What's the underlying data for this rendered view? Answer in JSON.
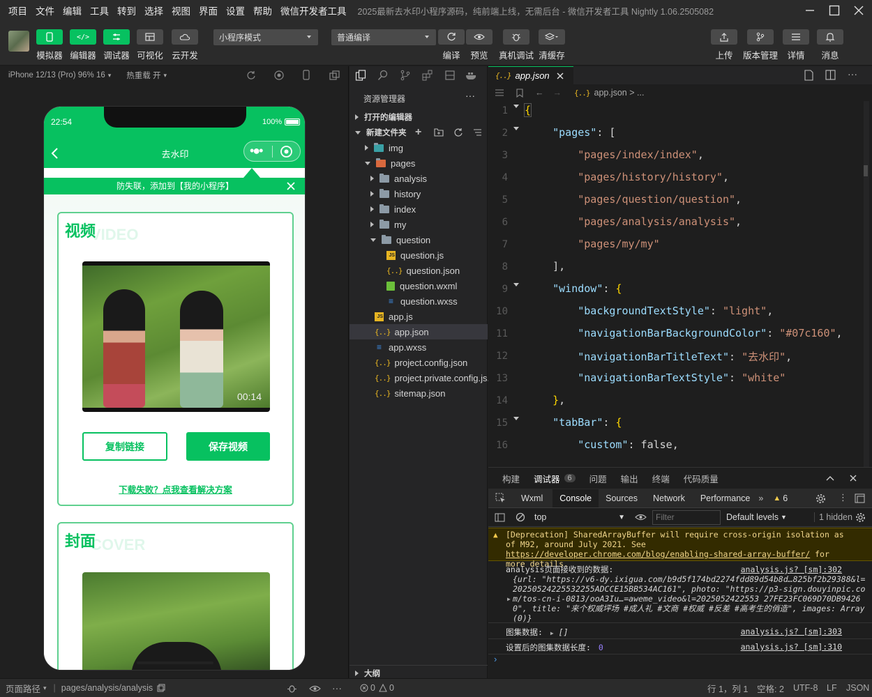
{
  "menu": [
    "项目",
    "文件",
    "编辑",
    "工具",
    "转到",
    "选择",
    "视图",
    "界面",
    "设置",
    "帮助",
    "微信开发者工具"
  ],
  "window_title": "2025最新去水印小程序源码，纯前端上线，无需后台 - 微信开发者工具 Nightly 1.06.2505082",
  "toolbar": {
    "left_buttons": [
      "模拟器",
      "编辑器",
      "调试器",
      "可视化",
      "云开发"
    ],
    "mode_select": "小程序模式",
    "compile_select": "普通编译",
    "mid_buttons": [
      "编译",
      "预览",
      "真机调试",
      "清缓存"
    ],
    "right_buttons": [
      "上传",
      "版本管理",
      "详情",
      "消息"
    ]
  },
  "simulator": {
    "device": "iPhone 12/13 (Pro) 96% 16",
    "hot_reload": "热重载 开",
    "time": "22:54",
    "battery": "100%",
    "nav_title": "去水印",
    "tip": "防失联，添加到【我的小程序】",
    "video_card": {
      "title": "视频",
      "ghost": "VIDEO",
      "duration": "00:14",
      "copy_btn": "复制链接",
      "save_btn": "保存视频",
      "help_link": "下载失败？点我查看解决方案"
    },
    "cover_card": {
      "title": "封面",
      "ghost": "COVER"
    }
  },
  "explorer": {
    "header": "资源管理器",
    "open_editors": "打开的编辑器",
    "project": "新建文件夹",
    "items": [
      {
        "name": "img",
        "type": "folder",
        "depth": 1,
        "expanded": false
      },
      {
        "name": "pages",
        "type": "folder",
        "depth": 1,
        "expanded": true
      },
      {
        "name": "analysis",
        "type": "folder",
        "depth": 2,
        "expanded": false
      },
      {
        "name": "history",
        "type": "folder",
        "depth": 2,
        "expanded": false
      },
      {
        "name": "index",
        "type": "folder",
        "depth": 2,
        "expanded": false
      },
      {
        "name": "my",
        "type": "folder",
        "depth": 2,
        "expanded": false
      },
      {
        "name": "question",
        "type": "folder",
        "depth": 2,
        "expanded": true
      },
      {
        "name": "question.js",
        "type": "js",
        "depth": 3
      },
      {
        "name": "question.json",
        "type": "json",
        "depth": 3
      },
      {
        "name": "question.wxml",
        "type": "wxml",
        "depth": 3
      },
      {
        "name": "question.wxss",
        "type": "wxss",
        "depth": 3
      },
      {
        "name": "app.js",
        "type": "js",
        "depth": 1
      },
      {
        "name": "app.json",
        "type": "json",
        "depth": 1,
        "selected": true
      },
      {
        "name": "app.wxss",
        "type": "wxss",
        "depth": 1
      },
      {
        "name": "project.config.json",
        "type": "json",
        "depth": 1
      },
      {
        "name": "project.private.config.js...",
        "type": "json",
        "depth": 1
      },
      {
        "name": "sitemap.json",
        "type": "json",
        "depth": 1
      }
    ],
    "outline": "大纲"
  },
  "editor": {
    "tab": "app.json",
    "breadcrumb": "app.json > ...",
    "line_numbers": [
      "1",
      "2",
      "3",
      "4",
      "5",
      "6",
      "7",
      "8",
      "9",
      "10",
      "11",
      "12",
      "13",
      "14",
      "15",
      "16"
    ],
    "code_lines": [
      "{",
      "    \"pages\": [",
      "        \"pages/index/index\",",
      "        \"pages/history/history\",",
      "        \"pages/question/question\",",
      "        \"pages/analysis/analysis\",",
      "        \"pages/my/my\"",
      "    ],",
      "    \"window\": {",
      "        \"backgroundTextStyle\": \"light\",",
      "        \"navigationBarBackgroundColor\": \"#07c160\",",
      "        \"navigationBarTitleText\": \"去水印\",",
      "        \"navigationBarTextStyle\": \"white\"",
      "    },",
      "    \"tabBar\": {",
      "        \"custom\": false,"
    ]
  },
  "panel": {
    "tabs": [
      "构建",
      "调试器",
      "问题",
      "输出",
      "终端",
      "代码质量"
    ],
    "debugger_badge": "6",
    "devtools_tabs": [
      "Wxml",
      "Console",
      "Sources",
      "Network",
      "Performance"
    ],
    "warn_count": "6",
    "context": "top",
    "filter_placeholder": "Filter",
    "levels": "Default levels",
    "hidden": "1 hidden",
    "warning_msg": "[Deprecation] SharedArrayBuffer will require cross-origin isolation as of M92, around July 2021. See ",
    "warning_link": "https://developer.chrome.com/blog/enabling-shared-array-buffer/",
    "warning_tail": " for more details.",
    "log1_label": "analysis页面接收到的数据:",
    "log1_src": "analysis.js? [sm]:302",
    "log1_body": "{url: \"https://v6-dy.ixigua.com/b9d5f174bd2274fdd89d54b8d…825bf2b29388&l=20250524225532255ADCCE15BB534AC161\", photo: \"https://p3-sign.douyinpic.com/tos-cn-i-0813/ooA3Iu…=aweme_video&l=2025052422553 27FE23FC069D70DB94260\", title: \"来个权威坪场 #成人礼 #文商 #权威 #反差 #高考生的俏造\", images: Array(0)}",
    "log2_label": "图集数据:",
    "log2_val": "[]",
    "log2_src": "analysis.js? [sm]:303",
    "log3_label": "设置后的图集数据长度:",
    "log3_val": "0",
    "log3_src": "analysis.js? [sm]:310"
  },
  "status": {
    "page_path_label": "页面路径",
    "page_path": "pages/analysis/analysis",
    "errors": "0",
    "warnings": "0",
    "position": "行 1，列 1",
    "spaces": "空格: 2",
    "encoding": "UTF-8",
    "eol": "LF",
    "lang": "JSON"
  },
  "colors": {
    "brand": "#07c160"
  }
}
